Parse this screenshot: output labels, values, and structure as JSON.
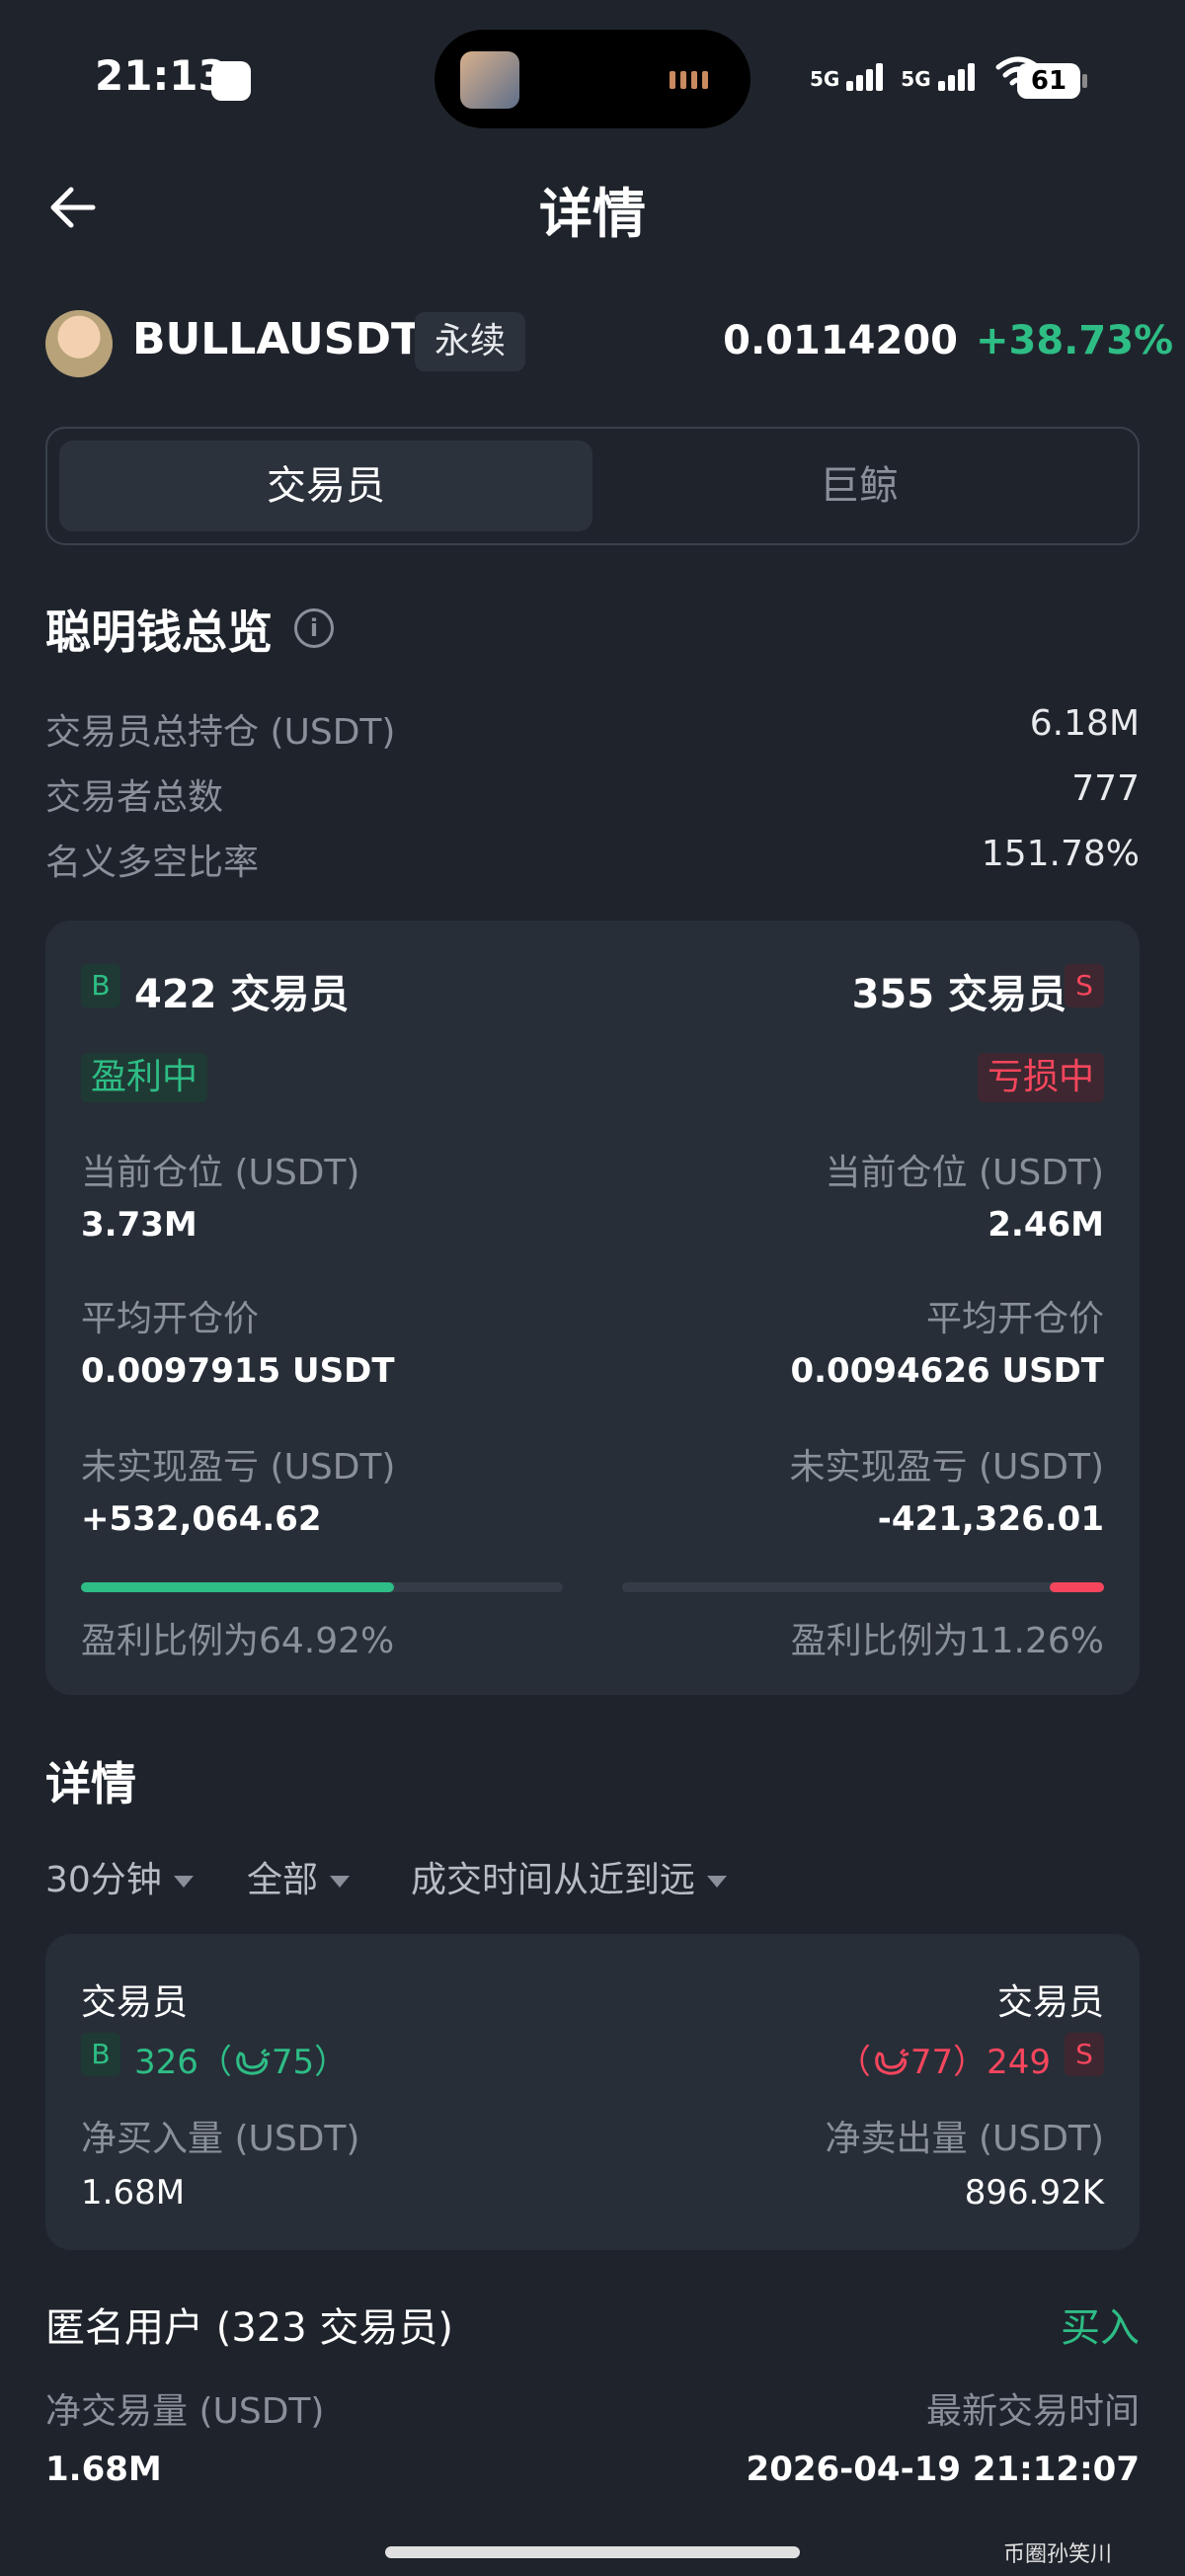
{
  "status_bar": {
    "time": "21:13",
    "net1": "5G",
    "net2": "5G",
    "battery": "61"
  },
  "header": {
    "title": "详情"
  },
  "symbol": {
    "name": "BULLAUSDT",
    "type": "永续",
    "price": "0.0114200",
    "change": "+38.73%"
  },
  "tabs": [
    {
      "label": "交易员"
    },
    {
      "label": "巨鲸"
    }
  ],
  "overview": {
    "title": "聪明钱总览",
    "rows": [
      {
        "label": "交易员总持仓 (USDT)",
        "value": "6.18M"
      },
      {
        "label": "交易者总数",
        "value": "777"
      },
      {
        "label": "名义多空比率",
        "value": "151.78%"
      }
    ]
  },
  "card": {
    "long": {
      "badge": "B",
      "count": "422 交易员",
      "status": "盈利中",
      "pos_label": "当前仓位 (USDT)",
      "pos_value": "3.73M",
      "avg_label": "平均开仓价",
      "avg_value": "0.0097915 USDT",
      "pnl_label": "未实现盈亏 (USDT)",
      "pnl_value": "+532,064.62",
      "ratio_text": "盈利比例为64.92%",
      "ratio": 0.6492
    },
    "short": {
      "badge": "S",
      "count": "355 交易员",
      "status": "亏损中",
      "pos_label": "当前仓位 (USDT)",
      "pos_value": "2.46M",
      "avg_label": "平均开仓价",
      "avg_value": "0.0094626 USDT",
      "pnl_label": "未实现盈亏 (USDT)",
      "pnl_value": "-421,326.01",
      "ratio_text": "盈利比例为11.26%",
      "ratio": 0.1126
    }
  },
  "details": {
    "title": "详情",
    "filters": [
      "30分钟",
      "全部",
      "成交时间从近到远"
    ],
    "summary": {
      "left_label": "交易员",
      "right_label": "交易员",
      "left_badge": "B",
      "left_count": "326（",
      "left_whales": "75）",
      "right_pre": "（",
      "right_whales": "77）249",
      "right_badge": "S",
      "buy_label": "净买入量 (USDT)",
      "buy_value": "1.68M",
      "sell_label": "净卖出量 (USDT)",
      "sell_value": "896.92K"
    },
    "anon": {
      "title": "匿名用户 (323 交易员)",
      "action": "买入",
      "vol_label": "净交易量 (USDT)",
      "vol_value": "1.68M",
      "time_label": "最新交易时间",
      "time_value": "2026-04-19 21:12:07"
    }
  },
  "watermark": "币圈孙笑川"
}
